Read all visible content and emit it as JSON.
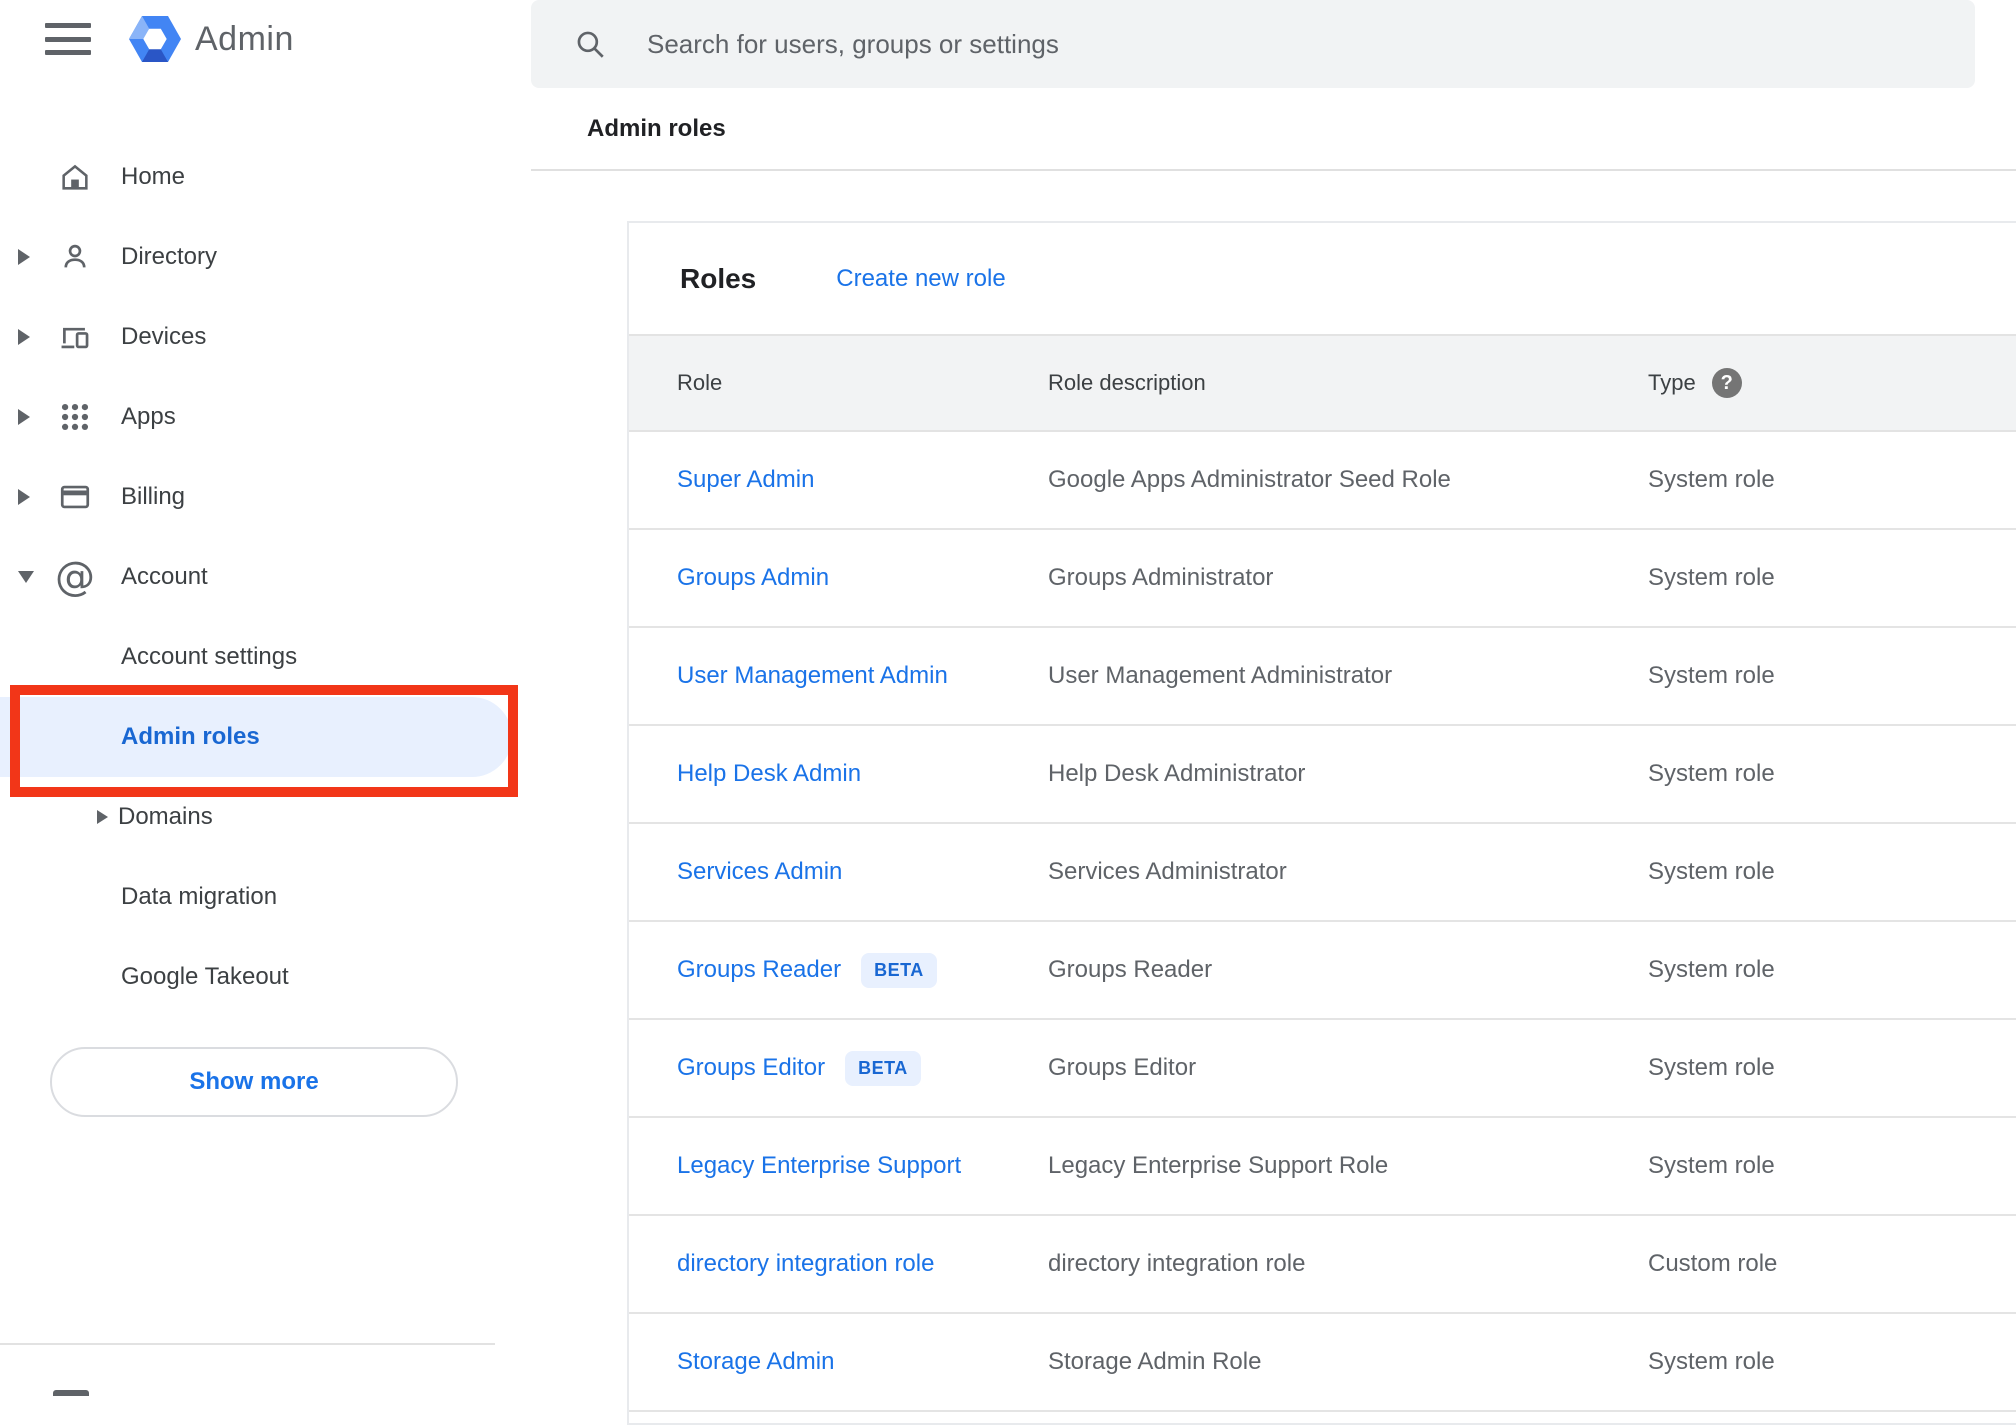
{
  "sidebar": {
    "app_title": "Admin",
    "items": [
      {
        "label": "Home",
        "icon": "home",
        "expandable": false
      },
      {
        "label": "Directory",
        "icon": "person",
        "expandable": true
      },
      {
        "label": "Devices",
        "icon": "devices",
        "expandable": true
      },
      {
        "label": "Apps",
        "icon": "apps-grid",
        "expandable": true
      },
      {
        "label": "Billing",
        "icon": "credit-card",
        "expandable": true
      },
      {
        "label": "Account",
        "icon": "at-sign",
        "icon_glyph": "@",
        "expandable": true,
        "expanded": true
      }
    ],
    "subitems": [
      {
        "label": "Account settings",
        "selected": false
      },
      {
        "label": "Admin roles",
        "selected": true,
        "annotated": true
      },
      {
        "label": "Domains",
        "expandable": true
      },
      {
        "label": "Data migration"
      },
      {
        "label": "Google Takeout"
      }
    ],
    "show_more_label": "Show more"
  },
  "search": {
    "placeholder": "Search for users, groups or settings"
  },
  "breadcrumb": {
    "label": "Admin roles"
  },
  "main": {
    "card_title": "Roles",
    "create_link": "Create new role",
    "table": {
      "columns": [
        "Role",
        "Role description",
        "Type"
      ],
      "help_glyph": "?",
      "rows": [
        {
          "role": "Super Admin",
          "description": "Google Apps Administrator Seed Role",
          "type": "System role"
        },
        {
          "role": "Groups Admin",
          "description": "Groups Administrator",
          "type": "System role"
        },
        {
          "role": "User Management Admin",
          "description": "User Management Administrator",
          "type": "System role"
        },
        {
          "role": "Help Desk Admin",
          "description": "Help Desk Administrator",
          "type": "System role"
        },
        {
          "role": "Services Admin",
          "description": "Services Administrator",
          "type": "System role"
        },
        {
          "role": "Groups Reader",
          "badge": "BETA",
          "description": "Groups Reader",
          "type": "System role"
        },
        {
          "role": "Groups Editor",
          "badge": "BETA",
          "description": "Groups Editor",
          "type": "System role"
        },
        {
          "role": "Legacy Enterprise Support",
          "description": "Legacy Enterprise Support Role",
          "type": "System role"
        },
        {
          "role": "directory integration role",
          "description": "directory integration role",
          "type": "Custom role"
        },
        {
          "role": "Storage Admin",
          "description": "Storage Admin Role",
          "type": "System role"
        }
      ]
    }
  },
  "colors": {
    "link_blue": "#1a73e8",
    "selected_blue": "#1967d2",
    "selected_pill_bg": "#e8f0fe",
    "annotation_red": "#f23618",
    "sidebar_text": "#3c4043",
    "muted_text": "#5f6368",
    "table_header_bg": "#f2f3f4",
    "search_bg": "#f1f3f4",
    "divider": "#e0e0e0"
  }
}
